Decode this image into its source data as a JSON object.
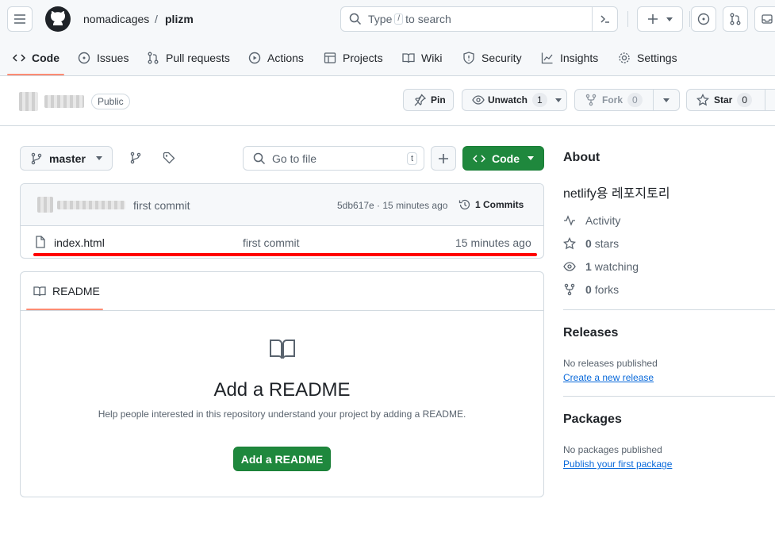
{
  "header": {
    "owner": "nomadicages",
    "separator": "/",
    "repo": "plizm",
    "search_placeholder_pre": "Type",
    "search_key": "/",
    "search_placeholder_post": "to search"
  },
  "tabs": [
    {
      "label": "Code"
    },
    {
      "label": "Issues"
    },
    {
      "label": "Pull requests"
    },
    {
      "label": "Actions"
    },
    {
      "label": "Projects"
    },
    {
      "label": "Wiki"
    },
    {
      "label": "Security"
    },
    {
      "label": "Insights"
    },
    {
      "label": "Settings"
    }
  ],
  "repo_head": {
    "visibility": "Public",
    "pin": "Pin",
    "unwatch": "Unwatch",
    "watch_count": "1",
    "fork": "Fork",
    "fork_count": "0",
    "star": "Star",
    "star_count": "0"
  },
  "file_nav": {
    "branch": "master",
    "goto_placeholder": "Go to file",
    "goto_key": "t",
    "code_button": "Code"
  },
  "commit": {
    "message": "first commit",
    "hash_time": "5db617e · 15 minutes ago",
    "commits_label": "1 Commits"
  },
  "files": [
    {
      "name": "index.html",
      "message": "first commit",
      "time": "15 minutes ago"
    }
  ],
  "readme": {
    "tab": "README",
    "title": "Add a README",
    "description": "Help people interested in this repository understand your project by adding a README.",
    "button": "Add a README"
  },
  "about": {
    "heading": "About",
    "description": "netlify용 레포지토리",
    "activity": "Activity",
    "stars_count": "0",
    "stars_label": "stars",
    "watching_count": "1",
    "watching_label": "watching",
    "forks_count": "0",
    "forks_label": "forks"
  },
  "releases": {
    "heading": "Releases",
    "empty": "No releases published",
    "link": "Create a new release"
  },
  "packages": {
    "heading": "Packages",
    "empty": "No packages published",
    "link": "Publish your first package"
  },
  "colors": {
    "accent_green": "#1f883d",
    "tab_underline": "#fd8c73",
    "annotation_red": "#ff0000",
    "link_blue": "#0969da"
  }
}
